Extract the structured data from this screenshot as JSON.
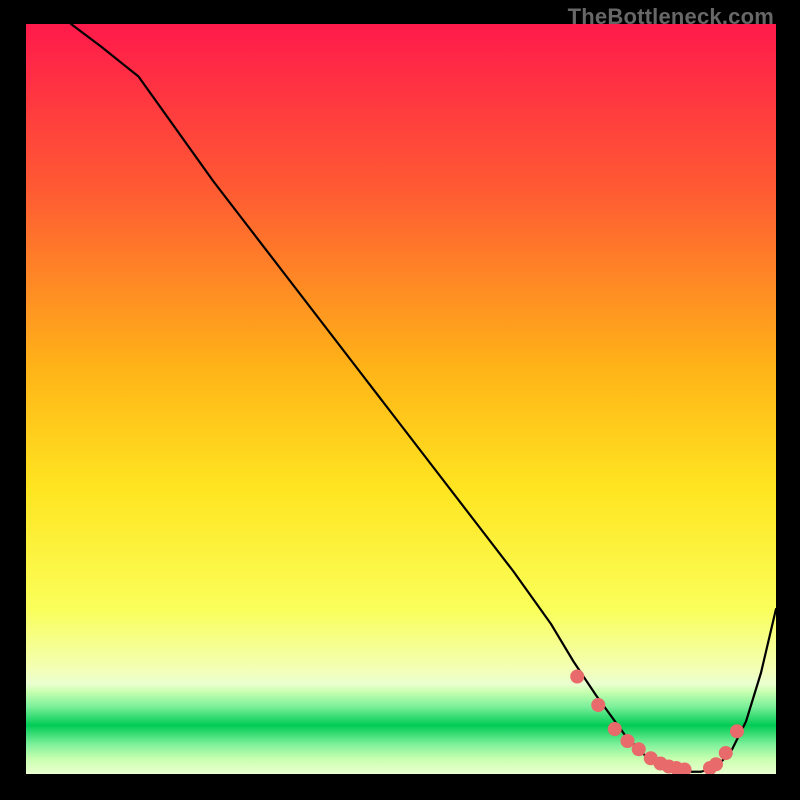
{
  "watermark": "TheBottleneck.com",
  "chart_data": {
    "type": "line",
    "title": "",
    "xlabel": "",
    "ylabel": "",
    "xlim": [
      0,
      100
    ],
    "ylim": [
      0,
      100
    ],
    "background_gradient": {
      "top": "#ff1a4b",
      "upper_mid": "#ff7f2a",
      "mid": "#ffe521",
      "lower_mid": "#f3ff6b",
      "green_band": "#00cc55",
      "bottom_band_start": 87,
      "bottom_band_end": 100
    },
    "series": [
      {
        "name": "curve",
        "color": "#000000",
        "stroke_width": 2.2,
        "x": [
          6,
          10,
          15,
          20,
          25,
          30,
          35,
          40,
          45,
          50,
          55,
          60,
          65,
          70,
          73,
          76,
          80,
          83,
          86,
          88,
          90,
          92,
          94,
          96,
          98,
          100
        ],
        "values": [
          100,
          97,
          93,
          86,
          79,
          72.5,
          66,
          59.5,
          53,
          46.5,
          40,
          33.5,
          27,
          20,
          15,
          10.5,
          5,
          2,
          0.6,
          0.3,
          0.3,
          0.9,
          3,
          7,
          13.5,
          22
        ]
      }
    ],
    "markers": {
      "name": "dots",
      "color": "#e86a6a",
      "radius": 7,
      "x": [
        73.5,
        76.3,
        78.5,
        80.2,
        81.7,
        83.3,
        84.6,
        85.7,
        86.7,
        87.8,
        91.2,
        92.0,
        93.3,
        94.8
      ],
      "values": [
        13.0,
        9.2,
        6.0,
        4.4,
        3.3,
        2.1,
        1.4,
        1.0,
        0.8,
        0.6,
        0.8,
        1.3,
        2.8,
        5.7
      ]
    }
  }
}
